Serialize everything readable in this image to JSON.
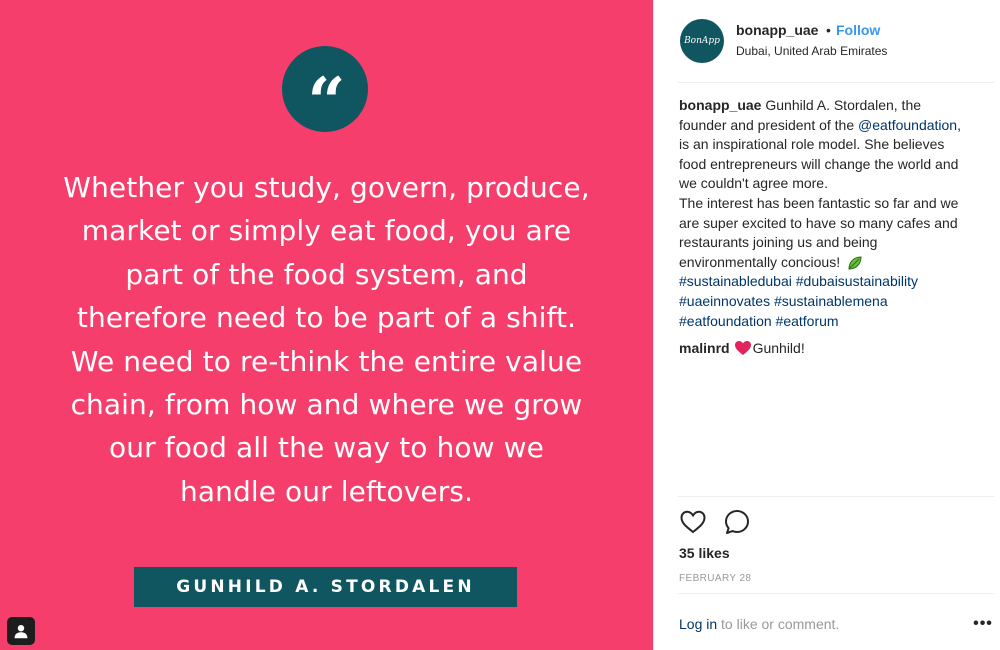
{
  "image": {
    "background_color": "#f63e6c",
    "accent_color": "#0f5661",
    "quote_mark": "“",
    "quote_lines": [
      "Whether you study, govern, produce,",
      "market or simply eat food, you are",
      "part of the food system, and",
      "therefore need to be part of a shift.",
      "We need to re-think the entire value",
      "chain, from how and where we grow",
      "our food all the way to how we",
      "handle our leftovers."
    ],
    "author": "GUNHILD A. STORDALEN",
    "user_tag_icon": "person-icon"
  },
  "header": {
    "avatar_text": "BonApp",
    "username": "bonapp_uae",
    "separator": "•",
    "follow_label": "Follow",
    "location": "Dubai, United Arab Emirates"
  },
  "caption": {
    "username": "bonapp_uae",
    "l1": " Gunhild A. Stordalen, the",
    "l2a": "founder and president of the ",
    "l2_mention": "@eatfoundation",
    "l2b": ",",
    "l3": "is an inspirational role model. She believes",
    "l4": "food entrepreneurs will change the world and",
    "l5": "we couldn't agree more.",
    "l6": "The interest has been fantastic so far and we",
    "l7": "are super excited to have so many cafes and",
    "l8": "restaurants joining us and being",
    "l9": "environmentally concious! ",
    "emoji_icon": "leaf-icon",
    "hashtags": [
      "#sustainabledubai",
      "#dubaisustainability",
      "#uaeinnovates",
      "#sustainablemena",
      "#eatfoundation",
      "#eatforum"
    ]
  },
  "comment": {
    "username": "malinrd",
    "heart_icon": "heart-emoji",
    "text": "Gunhild!"
  },
  "actions": {
    "like_icon": "heart-outline-icon",
    "comment_icon": "speech-bubble-icon",
    "likes": "35 likes",
    "date": "FEBRUARY 28"
  },
  "footer": {
    "login_link": "Log in",
    "login_rest": " to like or comment.",
    "more_label": "•••"
  },
  "colors": {
    "link": "#003569",
    "follow": "#3897f0",
    "muted": "#999999"
  }
}
